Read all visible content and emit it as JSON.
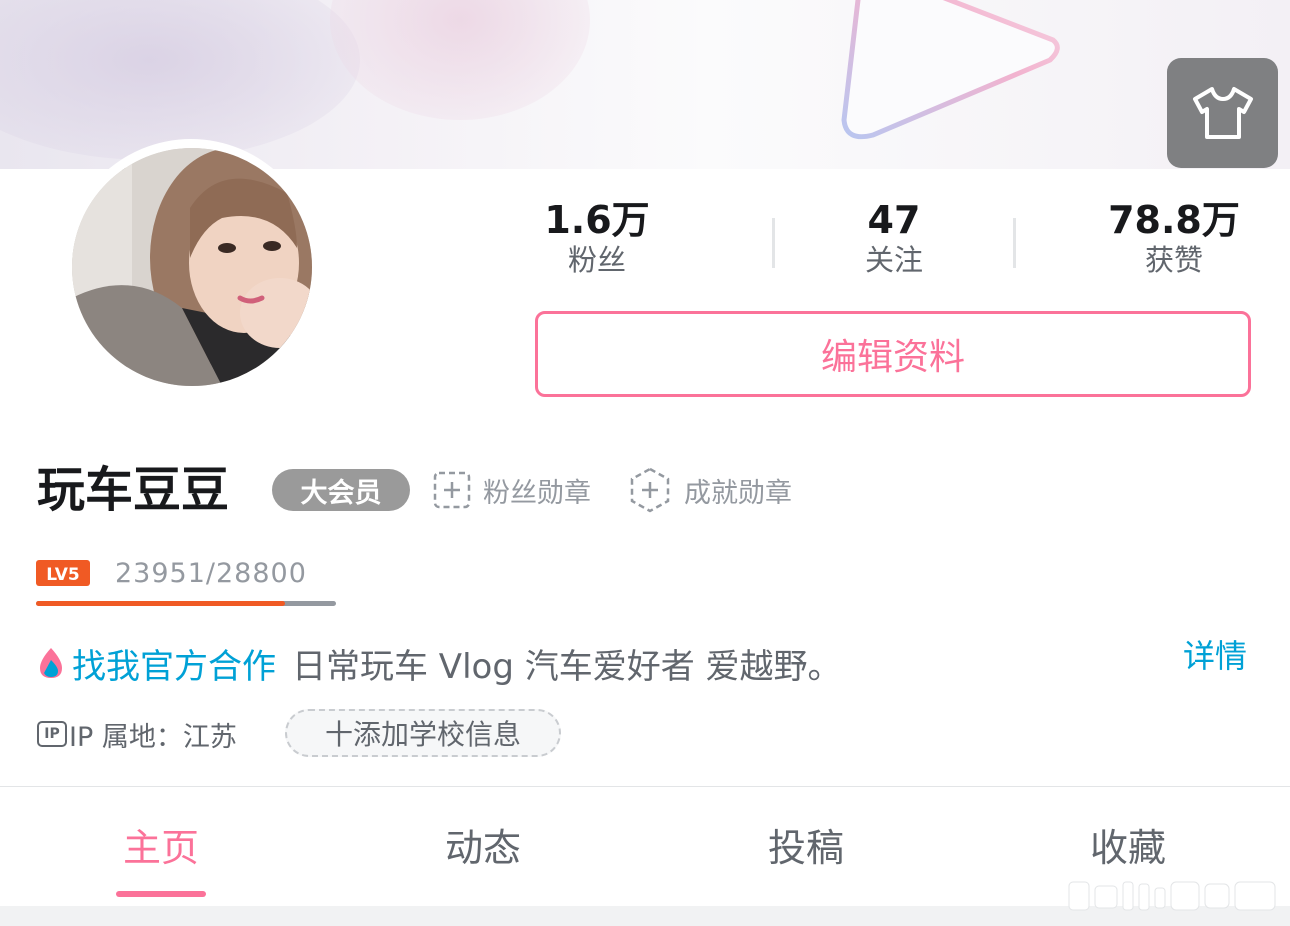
{
  "banner": {
    "skin_icon": "tshirt-icon"
  },
  "profile": {
    "name": "玩车豆豆",
    "vip_badge": "大会员",
    "medals": [
      {
        "label": "粉丝勋章",
        "icon": "add-square-icon"
      },
      {
        "label": "成就勋章",
        "icon": "add-hexagon-icon"
      }
    ]
  },
  "stats": [
    {
      "value": "1.6万",
      "label": "粉丝"
    },
    {
      "value": "47",
      "label": "关注"
    },
    {
      "value": "78.8万",
      "label": "获赞"
    }
  ],
  "edit_button": "编辑资料",
  "level": {
    "badge": "LV5",
    "exp_text": "23951/28800",
    "progress": 0.8316,
    "colors": {
      "fill": "#f05a24",
      "track": "#9499a0"
    }
  },
  "bio": {
    "link_text": "找我官方合作",
    "text": "日常玩车 Vlog 汽车爱好者 爱越野。",
    "detail": "详情"
  },
  "ip": {
    "badge": "IP",
    "label": "IP 属地：江苏"
  },
  "school_button": "十添加学校信息",
  "tabs": [
    {
      "label": "主页",
      "active": true
    },
    {
      "label": "动态",
      "active": false
    },
    {
      "label": "投稿",
      "active": false
    },
    {
      "label": "收藏",
      "active": false
    }
  ],
  "colors": {
    "accent": "#fb7299",
    "link": "#00a1d6"
  }
}
